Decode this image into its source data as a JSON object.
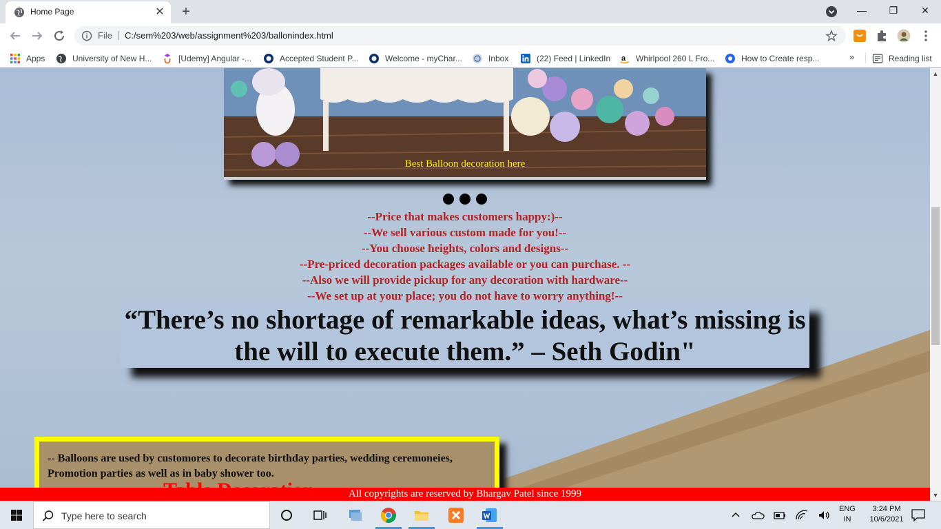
{
  "browser": {
    "tab_title": "Home Page",
    "new_tab_symbol": "+",
    "close_symbol": "✕",
    "scheme_label": "File",
    "url": "C:/sem%203/web/assignment%203/ballonindex.html",
    "window_controls": [
      "—",
      "❐",
      "✕"
    ]
  },
  "bookmarks": {
    "items": [
      {
        "label": "Apps",
        "icon": "apps-grid-icon"
      },
      {
        "label": "University of New H...",
        "icon": "globe-icon"
      },
      {
        "label": "[Udemy] Angular -...",
        "icon": "udemy-icon"
      },
      {
        "label": "Accepted Student P...",
        "icon": "university-icon"
      },
      {
        "label": "Welcome - myChar...",
        "icon": "university-icon"
      },
      {
        "label": "Inbox",
        "icon": "mail-icon"
      },
      {
        "label": "(22) Feed | LinkedIn",
        "icon": "linkedin-icon"
      },
      {
        "label": "Whirlpool 260 L Fro...",
        "icon": "amazon-icon"
      },
      {
        "label": "How to Create resp...",
        "icon": "edge-icon"
      }
    ],
    "more": "»",
    "reading_list": "Reading list"
  },
  "page": {
    "caption": "Best Balloon decoration here",
    "features": [
      "--Price that makes customers happy:)--",
      "--We sell various custom made for you!--",
      "--You choose heights, colors and designs--",
      "--Pre-priced decoration packages available or you can purchase. --",
      "--Also we will provide pickup for any decoration with hardware--",
      "--We set up at your place; you do not have to worry anything!--"
    ],
    "quote": "“There’s no shortage of remarkable ideas, what’s missing is the will to execute them.” – Seth Godin\"",
    "info_text": "-- Balloons are used by customores to decorate birthday parties, wedding ceremoneies, Promotion parties as well as in baby shower too.",
    "info_heading": "Table Decoration",
    "footer": "All copyrights are reserved by Bhargav Patel since 1999"
  },
  "taskbar": {
    "search_placeholder": "Type here to search",
    "lang_line1": "ENG",
    "lang_line2": "IN",
    "time": "3:24 PM",
    "date": "10/6/2021"
  }
}
